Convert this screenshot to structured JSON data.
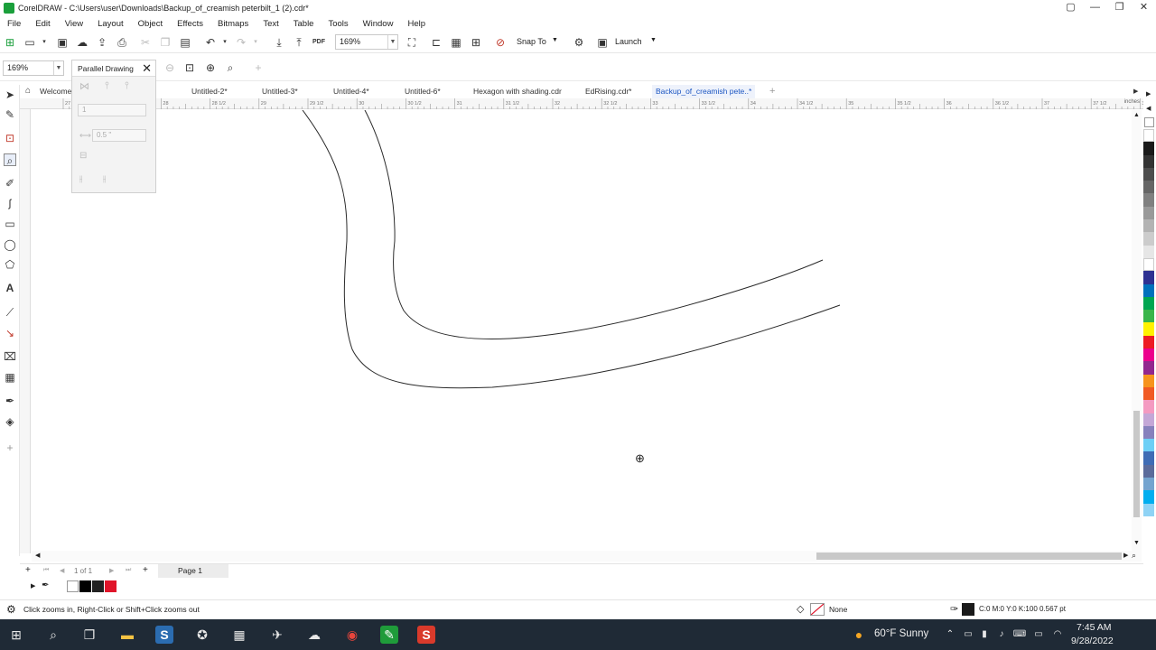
{
  "window": {
    "title": "CorelDRAW - C:\\Users\\user\\Downloads\\Backup_of_creamish peterbilt_1 (2).cdr*",
    "controls": [
      "▢",
      "—",
      "❐",
      "✕"
    ]
  },
  "menu": [
    "File",
    "Edit",
    "View",
    "Layout",
    "Object",
    "Effects",
    "Bitmaps",
    "Text",
    "Table",
    "Tools",
    "Window",
    "Help"
  ],
  "toolbar": {
    "zoom_value": "169%",
    "snap_to_label": "Snap To",
    "launch_label": "Launch"
  },
  "property_bar": {
    "zoom_value": "169%"
  },
  "parallel_docker": {
    "title": "Parallel Drawing",
    "count_value": "1",
    "distance_value": "0.5 \""
  },
  "tabs": [
    {
      "label": "Welcome"
    },
    {
      "label": "Untitled-2*"
    },
    {
      "label": "Untitled-3*"
    },
    {
      "label": "Untitled-4*"
    },
    {
      "label": "Untitled-6*"
    },
    {
      "label": "Hexagon with shading.cdr"
    },
    {
      "label": "EdRising.cdr*"
    },
    {
      "label": "Backup_of_creamish pete..*"
    }
  ],
  "ruler": {
    "units": "inches",
    "labels": [
      "27",
      "27 1/2",
      "28",
      "28 1/2",
      "29",
      "29 1/2",
      "30",
      "30 1/2",
      "31",
      "31 1/2",
      "32",
      "32 1/2",
      "33",
      "33 1/2",
      "34",
      "34 1/2",
      "35",
      "35 1/2",
      "36",
      "36 1/2",
      "37",
      "37 1/2",
      "38"
    ]
  },
  "page_nav": {
    "counter": "1 of 1",
    "page_tab": "Page 1"
  },
  "status": {
    "hint": "Click zooms in, Right-Click or Shift+Click zooms out",
    "fill_label": "None",
    "outline_info": "C:0 M:0 Y:0 K:100  0.567 pt"
  },
  "taskbar": {
    "weather": "60°F  Sunny",
    "time": "7:45 AM",
    "date": "9/28/2022"
  },
  "palette_colors": [
    "#ffffff",
    "#1a1a1a",
    "#333333",
    "#4d4d4d",
    "#666666",
    "#808080",
    "#999999",
    "#b3b3b3",
    "#cccccc",
    "#e6e6e6",
    "#ffffff",
    "#2e3192",
    "#0071bc",
    "#00a651",
    "#39b54a",
    "#fff200",
    "#ed1c24",
    "#ec008c",
    "#92278f",
    "#f7941d",
    "#f15a24",
    "#f49ac1",
    "#c4a7d7",
    "#8781bd",
    "#6dcff6",
    "#3f6cb5",
    "#5b6b9b",
    "#74a4cf",
    "#00aeef",
    "#8fd3f5"
  ]
}
